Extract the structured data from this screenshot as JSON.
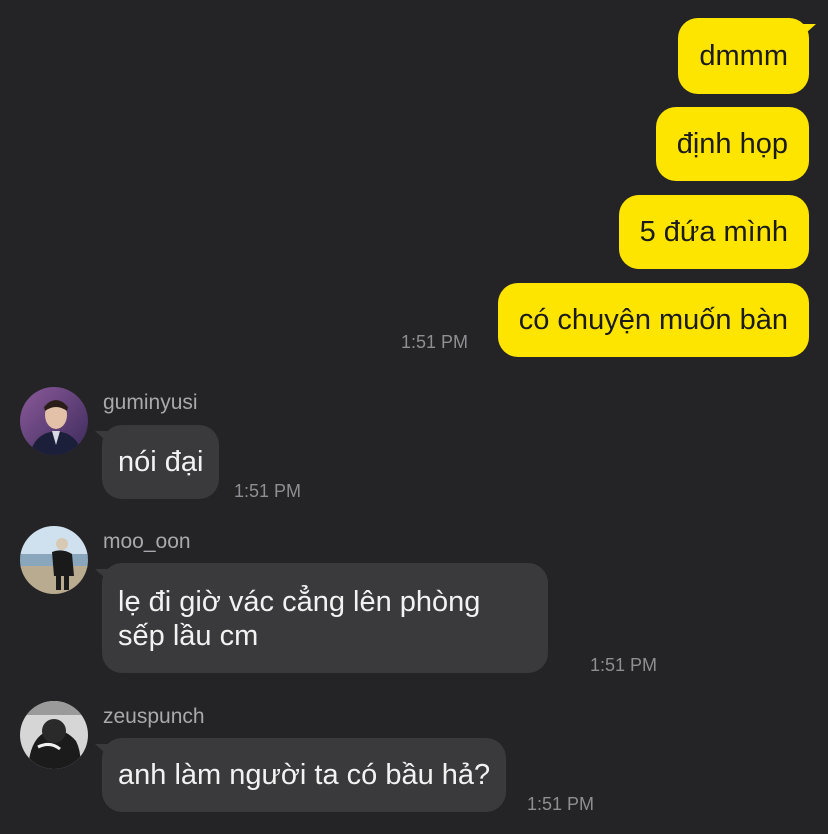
{
  "outgoing": [
    {
      "text": "dmmm"
    },
    {
      "text": "định họp"
    },
    {
      "text": "5 đứa mình"
    },
    {
      "text": "có chuyện muốn bàn"
    }
  ],
  "outgoing_time": "1:51 PM",
  "incoming": [
    {
      "sender": "guminyusi",
      "text": "nói đại",
      "time": "1:51 PM",
      "avatar": "person-suit-photo"
    },
    {
      "sender": "moo_oon",
      "text": "lẹ đi giờ vác cẳng lên phòng sếp lầu cm",
      "time": "1:51 PM",
      "avatar": "beach-person-photo"
    },
    {
      "sender": "zeuspunch",
      "text": "anh làm người ta có bầu hả?",
      "time": "1:51 PM",
      "avatar": "monochrome-person-photo"
    }
  ],
  "colors": {
    "background": "#242426",
    "outgoing_bubble": "#fee500",
    "incoming_bubble": "#3a3a3c"
  }
}
